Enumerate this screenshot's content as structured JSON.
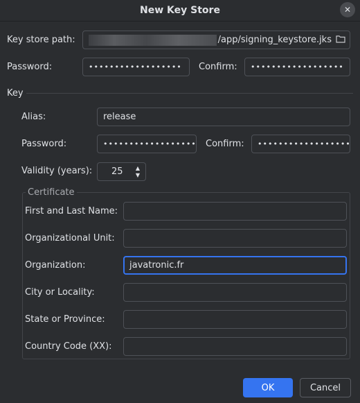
{
  "window": {
    "title": "New Key Store",
    "close_icon": "close-icon"
  },
  "keystore": {
    "path_label": "Key store path:",
    "path_value": "/app/signing_keystore.jks",
    "password_label": "Password:",
    "password_mask": "••••••••••••••••••",
    "confirm_label": "Confirm:",
    "confirm_mask": "••••••••••••••••••"
  },
  "key": {
    "section_title": "Key",
    "alias_label": "Alias:",
    "alias_value": "release",
    "password_label": "Password:",
    "password_mask": "••••••••••••••••••",
    "confirm_label": "Confirm:",
    "confirm_mask": "••••••••••••••••••",
    "validity_label": "Validity (years):",
    "validity_value": "25"
  },
  "certificate": {
    "title": "Certificate",
    "first_last_label": "First and Last Name:",
    "first_last_value": "",
    "org_unit_label": "Organizational Unit:",
    "org_unit_value": "",
    "org_label": "Organization:",
    "org_value": "javatronic.fr",
    "city_label": "City or Locality:",
    "city_value": "",
    "state_label": "State or Province:",
    "state_value": "",
    "country_label": "Country Code (XX):",
    "country_value": ""
  },
  "buttons": {
    "ok": "OK",
    "cancel": "Cancel"
  },
  "colors": {
    "accent": "#3574f0",
    "background": "#2b2d30",
    "border": "#4e5157"
  }
}
